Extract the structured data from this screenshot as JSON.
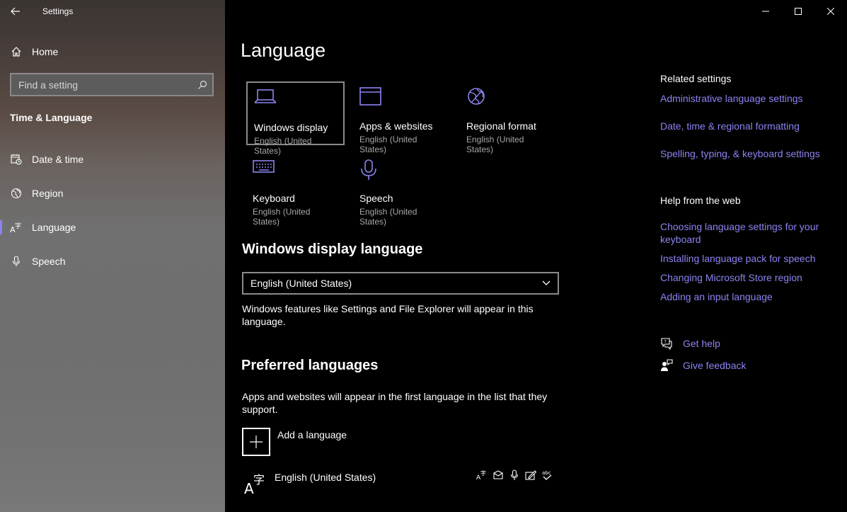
{
  "app": {
    "title": "Settings"
  },
  "sidebar": {
    "home_label": "Home",
    "search_placeholder": "Find a setting",
    "section_title": "Time & Language",
    "items": [
      {
        "label": "Date & time",
        "icon": "calendar-clock-icon"
      },
      {
        "label": "Region",
        "icon": "globe-icon"
      },
      {
        "label": "Language",
        "icon": "language-icon",
        "active": true
      },
      {
        "label": "Speech",
        "icon": "microphone-icon"
      }
    ]
  },
  "main": {
    "title": "Language",
    "tiles": [
      {
        "title": "Windows display",
        "subtitle": "English (United States)",
        "icon": "laptop-icon",
        "selected": true
      },
      {
        "title": "Apps & websites",
        "subtitle": "English (United States)",
        "icon": "window-icon"
      },
      {
        "title": "Regional format",
        "subtitle": "English (United States)",
        "icon": "globe-settings-icon"
      },
      {
        "title": "Keyboard",
        "subtitle": "English (United States)",
        "icon": "keyboard-icon"
      },
      {
        "title": "Speech",
        "subtitle": "English (United States)",
        "icon": "microphone-icon"
      }
    ],
    "display_language": {
      "heading": "Windows display language",
      "selected_value": "English (United States)",
      "description": "Windows features like Settings and File Explorer will appear in this language."
    },
    "preferred": {
      "heading": "Preferred languages",
      "description": "Apps and websites will appear in the first language in the list that they support.",
      "add_label": "Add a language",
      "languages": [
        {
          "name": "English (United States)"
        }
      ]
    }
  },
  "related": {
    "heading": "Related settings",
    "links": [
      "Administrative language settings",
      "Date, time & regional formatting",
      "Spelling, typing, & keyboard settings"
    ]
  },
  "help_web": {
    "heading": "Help from the web",
    "links": [
      "Choosing language settings for your keyboard",
      "Installing language pack for speech",
      "Changing Microsoft Store region",
      "Adding an input language"
    ]
  },
  "support": {
    "get_help": "Get help",
    "give_feedback": "Give feedback"
  },
  "colors": {
    "accent": "#8b84f0",
    "background": "#000000",
    "subtext": "#a8a8a8"
  }
}
